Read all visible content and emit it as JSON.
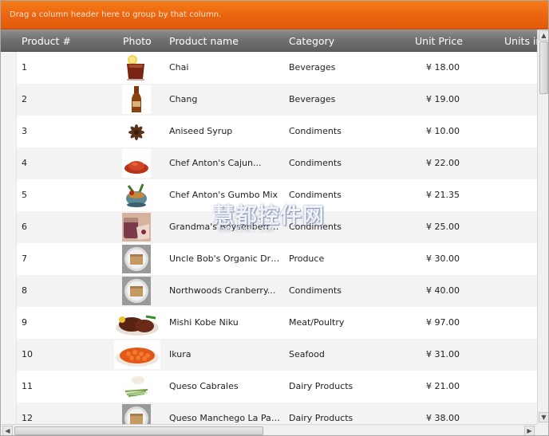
{
  "group_panel": {
    "text": "Drag a column header here to group by that column."
  },
  "columns": [
    {
      "key": "id",
      "label": "Product #"
    },
    {
      "key": "photo",
      "label": "Photo"
    },
    {
      "key": "name",
      "label": "Product name"
    },
    {
      "key": "category",
      "label": "Category"
    },
    {
      "key": "price",
      "label": "Unit Price"
    },
    {
      "key": "units",
      "label": "Units in"
    }
  ],
  "rows": [
    {
      "id": "1",
      "photo_icon": "tea-glass-icon",
      "name": "Chai",
      "category": "Beverages",
      "price": "¥ 18.00"
    },
    {
      "id": "2",
      "photo_icon": "beer-bottle-icon",
      "name": "Chang",
      "category": "Beverages",
      "price": "¥ 19.00"
    },
    {
      "id": "3",
      "photo_icon": "star-anise-icon",
      "name": "Aniseed Syrup",
      "category": "Condiments",
      "price": "¥ 10.00"
    },
    {
      "id": "4",
      "photo_icon": "spice-pile-icon",
      "name": "Chef Anton's Cajun...",
      "category": "Condiments",
      "price": "¥ 22.00"
    },
    {
      "id": "5",
      "photo_icon": "gumbo-pot-icon",
      "name": "Chef Anton's Gumbo Mix",
      "category": "Condiments",
      "price": "¥ 21.35"
    },
    {
      "id": "6",
      "photo_icon": "berry-jar-icon",
      "name": "Grandma's Boysenberry...",
      "category": "Condiments",
      "price": "¥ 25.00"
    },
    {
      "id": "7",
      "photo_icon": "placeholder-box-icon",
      "name": "Uncle Bob's Organic Dried...",
      "category": "Produce",
      "price": "¥ 30.00"
    },
    {
      "id": "8",
      "photo_icon": "placeholder-box-icon",
      "name": "Northwoods Cranberry...",
      "category": "Condiments",
      "price": "¥ 40.00"
    },
    {
      "id": "9",
      "photo_icon": "steak-plate-icon",
      "name": "Mishi Kobe Niku",
      "category": "Meat/Poultry",
      "price": "¥ 97.00"
    },
    {
      "id": "10",
      "photo_icon": "salmon-roe-icon",
      "name": "Ikura",
      "category": "Seafood",
      "price": "¥ 31.00"
    },
    {
      "id": "11",
      "photo_icon": "cheese-herb-icon",
      "name": "Queso Cabrales",
      "category": "Dairy Products",
      "price": "¥ 21.00"
    },
    {
      "id": "12",
      "photo_icon": "placeholder-box-icon",
      "name": "Queso Manchego La Pastora",
      "category": "Dairy Products",
      "price": "¥ 38.00"
    }
  ],
  "watermark": {
    "main": "慧都控件网",
    "sub": "WWW.EVGET.COM"
  },
  "colors": {
    "group_panel": "#ea6410",
    "header": "#6f6f6f",
    "row_alt": "#f3f3f3"
  }
}
